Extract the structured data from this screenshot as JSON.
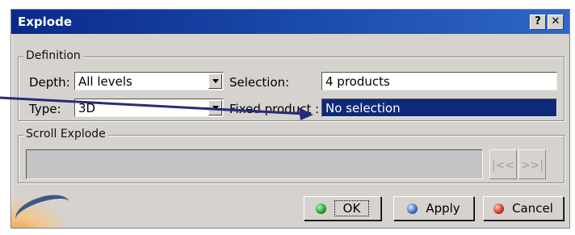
{
  "window": {
    "title": "Explode",
    "help_label": "?",
    "close_label": "✕"
  },
  "definition": {
    "legend": "Definition",
    "depth_label": "Depth:",
    "depth_value": "All levels",
    "type_label": "Type:",
    "type_value": "3D",
    "selection_label": "Selection:",
    "selection_value": "4 products",
    "fixed_product_label": "Fixed product :",
    "fixed_product_value": "No selection"
  },
  "scroll_explode": {
    "legend": "Scroll Explode",
    "first_label": "|<<",
    "last_label": ">>|"
  },
  "buttons": {
    "ok": "OK",
    "apply": "Apply",
    "cancel": "Cancel"
  },
  "colors": {
    "title_bar": "#0a2a8a",
    "selection_highlight": "#0d2a7a",
    "annotation_arrow": "#2a2a7a"
  }
}
